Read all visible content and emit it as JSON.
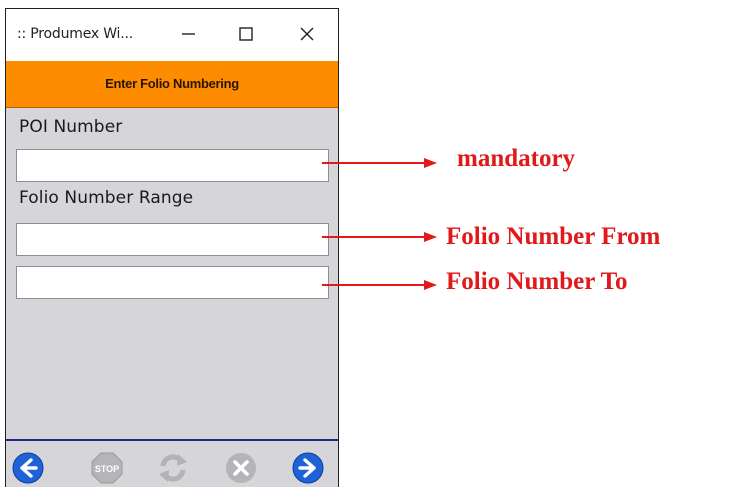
{
  "window": {
    "title": ":: Produmex Wi...",
    "controls": {
      "minimize": "minimize-icon",
      "maximize": "maximize-icon",
      "close": "close-icon"
    }
  },
  "header": {
    "title": "Enter Folio Numbering",
    "color": "#fd8c00"
  },
  "form": {
    "poi_label": "POI Number",
    "poi_value": "",
    "range_label": "Folio Number Range",
    "from_value": "",
    "to_value": ""
  },
  "toolbar": {
    "items": [
      {
        "icon": "back-arrow-icon",
        "enabled": true
      },
      {
        "icon": "stop-icon",
        "label": "STOP",
        "enabled": false
      },
      {
        "icon": "refresh-icon",
        "enabled": false
      },
      {
        "icon": "cancel-icon",
        "enabled": false
      },
      {
        "icon": "next-arrow-icon",
        "enabled": true
      }
    ],
    "accent": "#1e63d6"
  },
  "annotations": {
    "mandatory": "mandatory",
    "from": "Folio Number From",
    "to": "Folio Number To",
    "color": "#e1191a"
  }
}
